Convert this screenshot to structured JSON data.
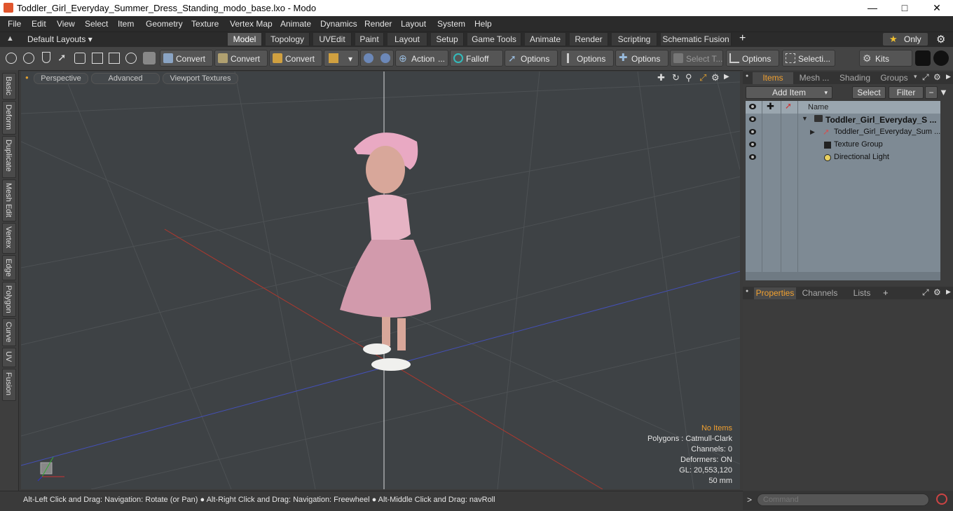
{
  "window": {
    "title": "Toddler_Girl_Everyday_Summer_Dress_Standing_modo_base.lxo - Modo"
  },
  "menu": [
    "File",
    "Edit",
    "View",
    "Select",
    "Item",
    "Geometry",
    "Texture",
    "Vertex Map",
    "Animate",
    "Dynamics",
    "Render",
    "Layout",
    "System",
    "Help"
  ],
  "layout_selector": "Default Layouts",
  "layout_tabs": [
    "Model",
    "Topology",
    "UVEdit",
    "Paint",
    "Layout",
    "Setup",
    "Game Tools",
    "Animate",
    "Render",
    "Scripting",
    "Schematic Fusion"
  ],
  "layout_add": "+",
  "only_label": "Only",
  "toolbar": {
    "convert1": "Convert",
    "convert2": "Convert",
    "convert3": "Convert",
    "action": "Action",
    "falloff": "Falloff",
    "options1": "Options",
    "options2": "Options",
    "options3": "Options",
    "select_t": "Select T...",
    "options4": "Options",
    "selecti": "Selecti...",
    "kits": "Kits"
  },
  "left_tabs": [
    "Basic",
    "Deform",
    "Duplicate",
    "Mesh Edit",
    "Vertex",
    "Edge",
    "Polygon",
    "Curve",
    "UV",
    "Fusion"
  ],
  "viewport": {
    "buttons": [
      "Perspective",
      "Advanced",
      "Viewport Textures"
    ],
    "stats": {
      "no_items": "No Items",
      "polygons": "Polygons : Catmull-Clark",
      "channels": "Channels: 0",
      "deformers": "Deformers: ON",
      "gl": "GL: 20,553,120",
      "size": "50 mm"
    }
  },
  "status": "Alt-Left Click and Drag: Navigation: Rotate (or Pan) ● Alt-Right Click and Drag: Navigation: Freewheel ● Alt-Middle Click and Drag: navRoll",
  "items_panel": {
    "tabs": [
      "Items",
      "Mesh ...",
      "Shading",
      "Groups"
    ],
    "add_item": "Add Item",
    "select": "Select",
    "filter": "Filter",
    "col_name": "Name",
    "rows": [
      "Toddler_Girl_Everyday_S ...",
      "Toddler_Girl_Everyday_Sum ...",
      "Texture Group",
      "Directional Light"
    ]
  },
  "properties_panel": {
    "tabs": [
      "Properties",
      "Channels",
      "Lists"
    ],
    "add": "+"
  },
  "command": {
    "placeholder": "Command",
    "prompt": ">"
  },
  "colors": {
    "accent": "#f0a030",
    "bg": "#3b3b3b",
    "viewport": "#3e4245"
  }
}
